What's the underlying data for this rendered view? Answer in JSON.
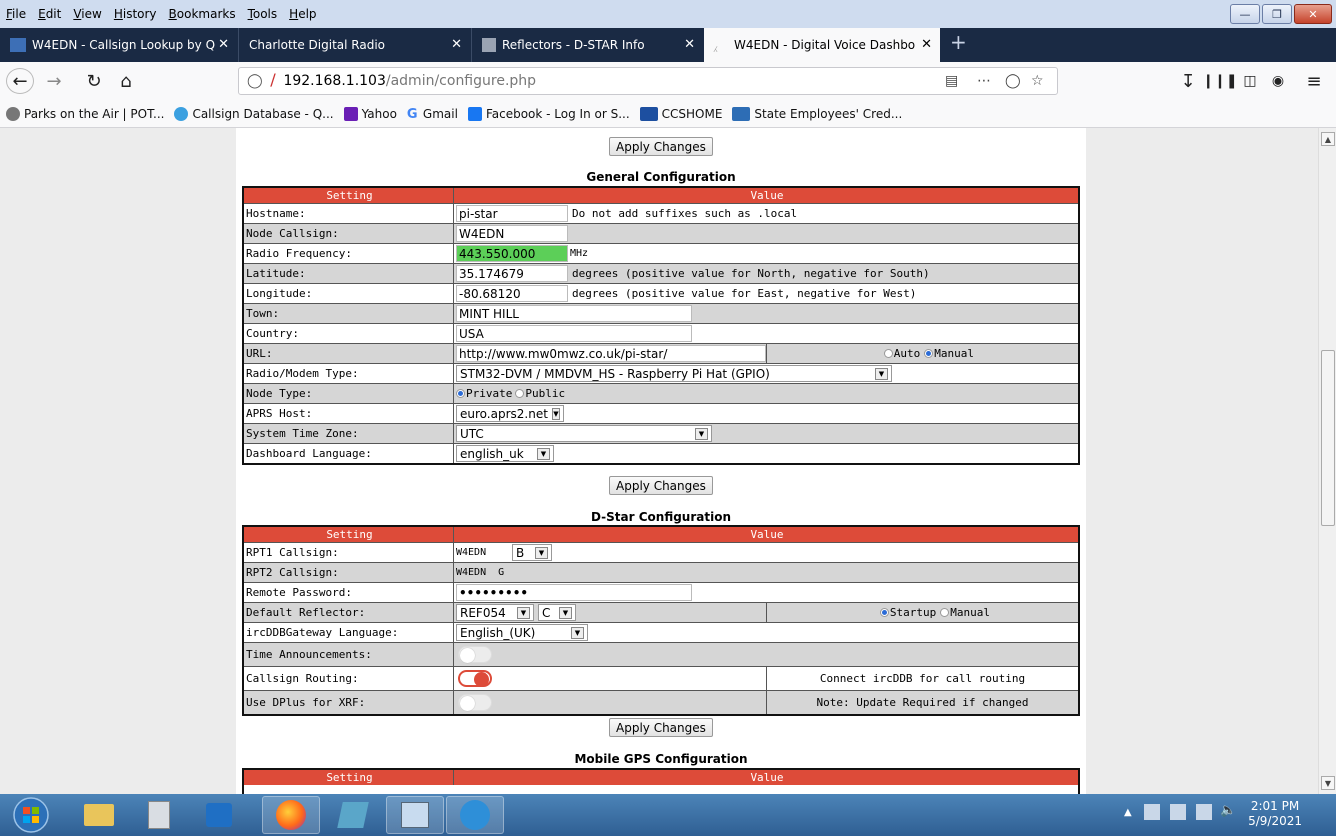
{
  "menubar": {
    "items": [
      "File",
      "Edit",
      "View",
      "History",
      "Bookmarks",
      "Tools",
      "Help"
    ]
  },
  "tabs": [
    {
      "label": "W4EDN - Callsign Lookup by Q",
      "active": false
    },
    {
      "label": "Charlotte Digital Radio",
      "active": false
    },
    {
      "label": "Reflectors - D-STAR Info",
      "active": false
    },
    {
      "label": "W4EDN - Digital Voice Dashbo",
      "active": true
    }
  ],
  "address": {
    "host": "192.168.1.103",
    "path": "/admin/configure.php"
  },
  "bookmarks": [
    "Parks on the Air | POT...",
    "Callsign Database - Q...",
    "Yahoo",
    "Gmail",
    "Facebook - Log In or S...",
    "CCSHOME",
    "State Employees' Cred..."
  ],
  "apply_label": "Apply Changes",
  "general": {
    "title": "General Configuration",
    "head_setting": "Setting",
    "head_value": "Value",
    "hostname": {
      "label": "Hostname:",
      "value": "pi-star",
      "note": "Do not add suffixes such as .local"
    },
    "callsign": {
      "label": "Node Callsign:",
      "value": "W4EDN"
    },
    "frequency": {
      "label": "Radio Frequency:",
      "value": "443.550.000",
      "unit": "MHz"
    },
    "latitude": {
      "label": "Latitude:",
      "value": "35.174679",
      "note": "degrees (positive value for North, negative for South)"
    },
    "longitude": {
      "label": "Longitude:",
      "value": "-80.68120",
      "note": "degrees (positive value for East, negative for West)"
    },
    "town": {
      "label": "Town:",
      "value": "MINT HILL"
    },
    "country": {
      "label": "Country:",
      "value": "USA"
    },
    "url": {
      "label": "URL:",
      "value": "http://www.mw0mwz.co.uk/pi-star/",
      "opt_auto": "Auto",
      "opt_manual": "Manual"
    },
    "modem": {
      "label": "Radio/Modem Type:",
      "value": "STM32-DVM / MMDVM_HS - Raspberry Pi Hat (GPIO)"
    },
    "nodetype": {
      "label": "Node Type:",
      "opt_private": "Private",
      "opt_public": "Public"
    },
    "aprs": {
      "label": "APRS Host:",
      "value": "euro.aprs2.net"
    },
    "timezone": {
      "label": "System Time Zone:",
      "value": "UTC"
    },
    "language": {
      "label": "Dashboard Language:",
      "value": "english_uk"
    }
  },
  "dstar": {
    "title": "D-Star Configuration",
    "head_setting": "Setting",
    "head_value": "Value",
    "rpt1": {
      "label": "RPT1 Callsign:",
      "value": "W4EDN",
      "module": "B"
    },
    "rpt2": {
      "label": "RPT2 Callsign:",
      "value": "W4EDN  G"
    },
    "password": {
      "label": "Remote Password:",
      "value": "•••••••••"
    },
    "reflector": {
      "label": "Default Reflector:",
      "value": "REF054",
      "module": "C",
      "opt_startup": "Startup",
      "opt_manual": "Manual"
    },
    "ircddb_lang": {
      "label": "ircDDBGateway Language:",
      "value": "English_(UK)"
    },
    "time_ann": {
      "label": "Time Announcements:"
    },
    "routing": {
      "label": "Callsign Routing:",
      "note": "Connect ircDDB for call routing"
    },
    "dplus": {
      "label": "Use DPlus for XRF:",
      "note": "Note: Update Required if changed"
    }
  },
  "gps": {
    "title": "Mobile GPS Configuration",
    "head_setting": "Setting",
    "head_value": "Value"
  },
  "clock": {
    "time": "2:01 PM",
    "date": "5/9/2021"
  }
}
